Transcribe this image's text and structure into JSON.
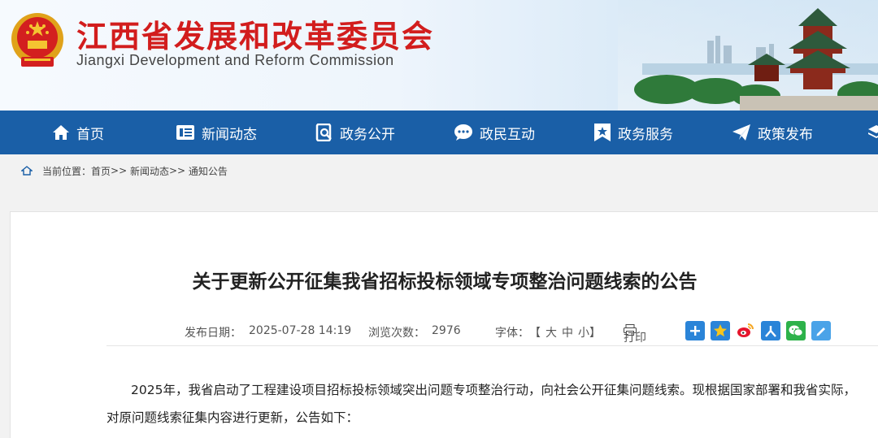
{
  "header": {
    "title": "江西省发展和改革委员会",
    "subtitle": "Jiangxi Development and Reform Commission",
    "emblem_icon": "national-emblem",
    "accent_color": "#d21d1d"
  },
  "nav": {
    "background": "#1a5fa7",
    "items": [
      {
        "label": "首页",
        "icon": "home-icon"
      },
      {
        "label": "新闻动态",
        "icon": "news-icon"
      },
      {
        "label": "政务公开",
        "icon": "search-doc-icon"
      },
      {
        "label": "政民互动",
        "icon": "chat-icon"
      },
      {
        "label": "政务服务",
        "icon": "star-bookmark-icon"
      },
      {
        "label": "政策发布",
        "icon": "paper-plane-icon"
      }
    ]
  },
  "breadcrumb": {
    "prefix": "当前位置：",
    "home": "首页",
    "sep1": ">>",
    "news": "新闻动态",
    "sep2": ">>",
    "current": "通知公告"
  },
  "article": {
    "title": "关于更新公开征集我省招标投标领域专项整治问题线索的公告",
    "publish_label": "发布日期：",
    "publish_date": "2025-07-28 14:19",
    "views_label": "浏览次数：",
    "views": "2976",
    "font_label": "字体：",
    "font_open": "【",
    "font_large": "大",
    "font_medium": "中",
    "font_small": "小",
    "font_close": "】",
    "print_label": "打印",
    "share_icons": [
      "share-plus-icon",
      "qzone-icon",
      "weibo-icon",
      "renren-icon",
      "wechat-icon",
      "edit-icon"
    ],
    "paragraph1_line1": "2025年，我省启动了工程建设项目招标投标领域突出问题专项整治行动，向社会公开征集问题线索。现根据国家部署和我省实际，",
    "paragraph1_line2": "对原问题线索征集内容进行更新，公告如下："
  }
}
